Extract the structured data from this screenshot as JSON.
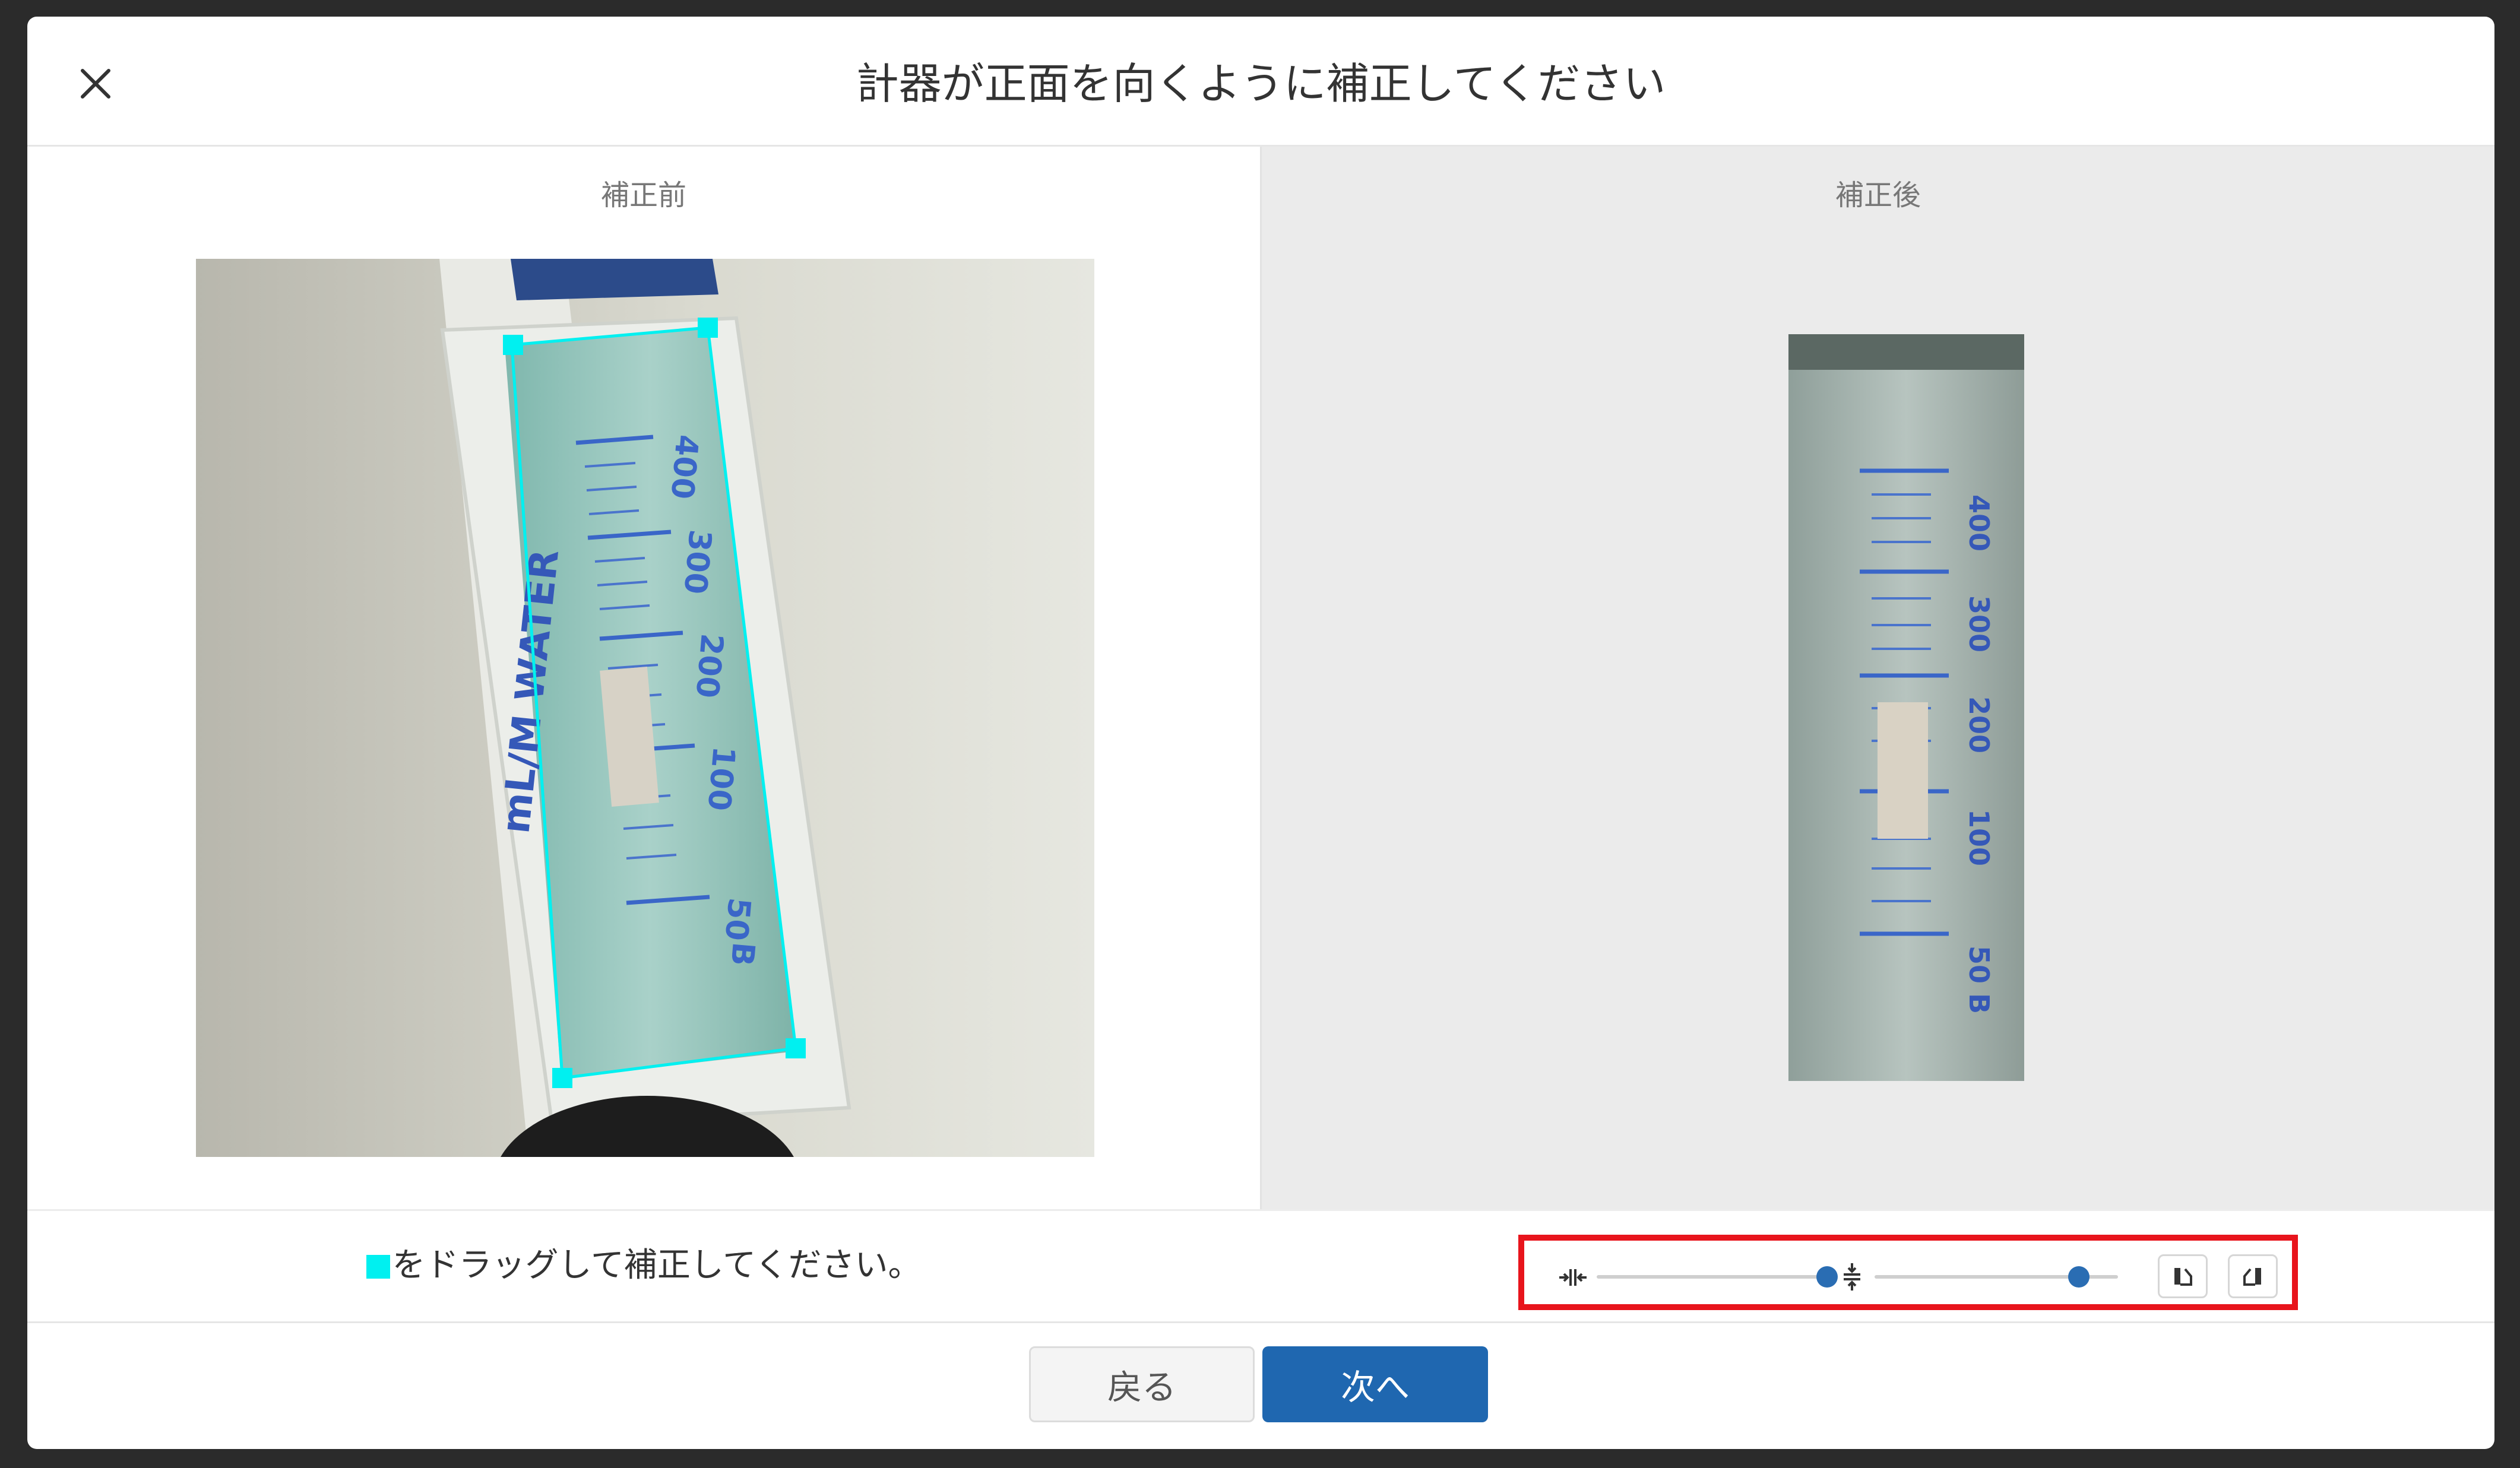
{
  "dialog": {
    "title": "計器が正面を向くように補正してください"
  },
  "before": {
    "label": "補正前",
    "hint": "をドラッグして補正してください。",
    "image": {
      "tube_text": "mL/M  WATER",
      "scale_numbers": [
        "400",
        "300",
        "200",
        "100",
        "50"
      ],
      "scale_letter": "B"
    }
  },
  "after": {
    "label": "補正後",
    "image": {
      "scale_numbers": [
        "400",
        "300",
        "200",
        "100",
        "50"
      ],
      "scale_letter": "B"
    }
  },
  "controls": {
    "width_slider": {
      "value_fraction": 0.97
    },
    "height_slider": {
      "value_fraction": 0.82
    }
  },
  "buttons": {
    "back": "戻る",
    "next": "次へ"
  },
  "colors": {
    "primary": "#1f67b0",
    "handle": "#00f0f0",
    "highlight_box": "#e8141c"
  }
}
